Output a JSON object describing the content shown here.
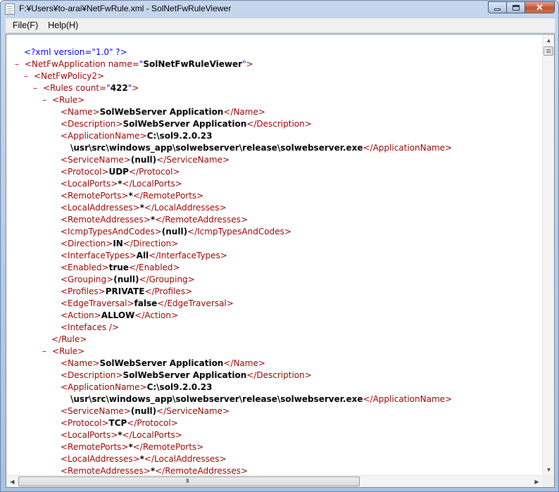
{
  "window": {
    "title": "F:¥Users¥to-arai¥NetFwRule.xml - SolNetFwRuleViewer",
    "controls": {
      "minimize": "minimize",
      "maximize": "maximize",
      "close": "✕"
    }
  },
  "menu": [
    "File(F)",
    "Help(H)"
  ],
  "xml": {
    "decl": "<?xml version=\"1.0\" ?>",
    "lines": [
      {
        "toggle": "–",
        "open": "<NetFwApplication",
        "attr": " name=",
        "q": "\"",
        "aval": "SolNetFwRuleViewer",
        "q2": "\"",
        "end": ">"
      },
      {
        "toggle": "–",
        "open": "<NetFwPolicy2>"
      },
      {
        "toggle": "–",
        "open": "<Rules",
        "attr": " count=",
        "q": "\"",
        "aval": "422",
        "q2": "\"",
        "end": ">"
      },
      {
        "toggle": "–",
        "open": "<Rule>"
      },
      {
        "open": "<Name>",
        "val": "SolWebServer Application",
        "close": "</Name>"
      },
      {
        "open": "<Description>",
        "val": "SolWebServer Application",
        "close": "</Description>"
      },
      {
        "open": "<ApplicationName>",
        "val": "C:\\sol9.2.0.23"
      },
      {
        "val": "\\usr\\src\\windows_app\\solwebserver\\release\\solwebserver.exe",
        "close": "</ApplicationName>"
      },
      {
        "open": "<ServiceName>",
        "val": "(null)",
        "close": "</ServiceName>"
      },
      {
        "open": "<Protocol>",
        "val": "UDP",
        "close": "</Protocol>"
      },
      {
        "open": "<LocalPorts>",
        "val": "*",
        "close": "</LocalPorts>"
      },
      {
        "open": "<RemotePorts>",
        "val": "*",
        "close": "</RemotePorts>"
      },
      {
        "open": "<LocalAddresses>",
        "val": "*",
        "close": "</LocalAddresses>"
      },
      {
        "open": "<RemoteAddresses>",
        "val": "*",
        "close": "</RemoteAddresses>"
      },
      {
        "open": "<IcmpTypesAndCodes>",
        "val": "(null)",
        "close": "</IcmpTypesAndCodes>"
      },
      {
        "open": "<Direction>",
        "val": "IN",
        "close": "</Direction>"
      },
      {
        "open": "<InterfaceTypes>",
        "val": "All",
        "close": "</InterfaceTypes>"
      },
      {
        "open": "<Enabled>",
        "val": "true",
        "close": "</Enabled>"
      },
      {
        "open": "<Grouping>",
        "val": "(null)",
        "close": "</Grouping>"
      },
      {
        "open": "<Profiles>",
        "val": "PRIVATE",
        "close": "</Profiles>"
      },
      {
        "open": "<EdgeTraversal>",
        "val": "false",
        "close": "</EdgeTraversal>"
      },
      {
        "open": "<Action>",
        "val": "ALLOW",
        "close": "</Action>"
      },
      {
        "open": "<Intefaces />"
      },
      {
        "close": "</Rule>"
      },
      {
        "toggle": "–",
        "open": "<Rule>"
      },
      {
        "open": "<Name>",
        "val": "SolWebServer Application",
        "close": "</Name>"
      },
      {
        "open": "<Description>",
        "val": "SolWebServer Application",
        "close": "</Description>"
      },
      {
        "open": "<ApplicationName>",
        "val": "C:\\sol9.2.0.23"
      },
      {
        "val": "\\usr\\src\\windows_app\\solwebserver\\release\\solwebserver.exe",
        "close": "</ApplicationName>"
      },
      {
        "open": "<ServiceName>",
        "val": "(null)",
        "close": "</ServiceName>"
      },
      {
        "open": "<Protocol>",
        "val": "TCP",
        "close": "</Protocol>"
      },
      {
        "open": "<LocalPorts>",
        "val": "*",
        "close": "</LocalPorts>"
      },
      {
        "open": "<RemotePorts>",
        "val": "*",
        "close": "</RemotePorts>"
      },
      {
        "open": "<LocalAddresses>",
        "val": "*",
        "close": "</LocalAddresses>"
      },
      {
        "open": "<RemoteAddresses>",
        "val": "*",
        "close": "</RemoteAddresses>"
      }
    ]
  },
  "scrollbar": {
    "grip": "III"
  },
  "colors": {
    "tag": "#990000",
    "punct": "#0000ff",
    "toggle": "#e00000",
    "frame": "#a9c2e2"
  }
}
